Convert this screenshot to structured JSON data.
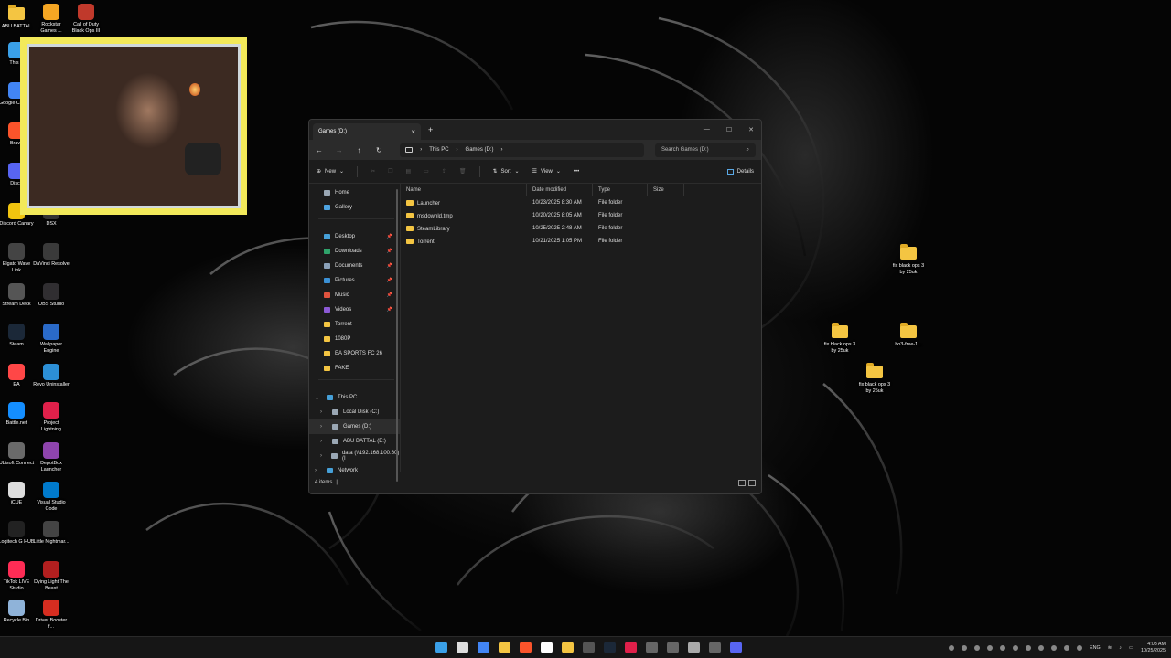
{
  "desktop": {
    "left_icons": [
      {
        "label": "ABU BATTAL",
        "icon": "folder-icon",
        "color": "#f4c542"
      },
      {
        "label": "Rockstar Games ...",
        "icon": "rockstar-icon",
        "color": "#f5a623"
      },
      {
        "label": "Call of Duty Black Ops III",
        "icon": "cod-icon",
        "color": "#c0392b"
      },
      {
        "label": "This P",
        "icon": "this-pc-icon",
        "color": "#3aa0e8"
      },
      {
        "label": "Google Chrome",
        "icon": "chrome-icon",
        "color": "#4285f4"
      },
      {
        "label": "Brave",
        "icon": "brave-icon",
        "color": "#fb542b"
      },
      {
        "label": "Disco",
        "icon": "discord-icon",
        "color": "#5865f2"
      },
      {
        "label": "Discord Canary",
        "icon": "discord-canary-icon",
        "color": "#f1c40f"
      },
      {
        "label": "DSX",
        "icon": "dsx-icon",
        "color": "#333333"
      },
      {
        "label": "Elgato Wave Link",
        "icon": "elgato-icon",
        "color": "#444444"
      },
      {
        "label": "DaVinci Resolve",
        "icon": "davinci-icon",
        "color": "#3a3a3a"
      },
      {
        "label": "Stream Deck",
        "icon": "stream-deck-icon",
        "color": "#555555"
      },
      {
        "label": "OBS Studio",
        "icon": "obs-icon",
        "color": "#302e31"
      },
      {
        "label": "Steam",
        "icon": "steam-icon",
        "color": "#1b2838"
      },
      {
        "label": "Wallpaper Engine",
        "icon": "wallpaper-engine-icon",
        "color": "#2a6ac8"
      },
      {
        "label": "EA",
        "icon": "ea-icon",
        "color": "#ff4747"
      },
      {
        "label": "Revo Uninstaller",
        "icon": "revo-icon",
        "color": "#2c8fd6"
      },
      {
        "label": "Battle.net",
        "icon": "battlenet-icon",
        "color": "#148eff"
      },
      {
        "label": "Project Lightning",
        "icon": "project-lightning-icon",
        "color": "#e0204a"
      },
      {
        "label": "Ubisoft Connect",
        "icon": "ubisoft-icon",
        "color": "#6a6a6a"
      },
      {
        "label": "DepotBox Launcher",
        "icon": "depotbox-icon",
        "color": "#8e44ad"
      },
      {
        "label": "iCUE",
        "icon": "icue-icon",
        "color": "#dddddd"
      },
      {
        "label": "Visual Studio Code",
        "icon": "vscode-icon",
        "color": "#007acc"
      },
      {
        "label": "Logitech G HUB",
        "icon": "logitech-icon",
        "color": "#222222"
      },
      {
        "label": "Little Nightmar...",
        "icon": "little-nightmares-icon",
        "color": "#444444"
      },
      {
        "label": "TikTok LIVE Studio",
        "icon": "tiktok-icon",
        "color": "#fe2c55"
      },
      {
        "label": "Dying Light The Beast",
        "icon": "dying-light-icon",
        "color": "#b21f1f"
      },
      {
        "label": "Recycle Bin",
        "icon": "recycle-bin-icon",
        "color": "#8fb3d9"
      },
      {
        "label": "Driver Booster f...",
        "icon": "driver-booster-icon",
        "color": "#d62d20"
      }
    ],
    "right_icons": [
      {
        "label": "fix black ops 3 by 25uk"
      },
      {
        "label": "fix black ops 3 by 25uk"
      },
      {
        "label": "bo3-free-1..."
      },
      {
        "label": "fix black ops 3 by 25uk"
      }
    ]
  },
  "explorer": {
    "tab_title": "Games (D:)",
    "new_tab": "+",
    "breadcrumb": [
      "This PC",
      "Games (D:)"
    ],
    "search_placeholder": "Search Games (D:)",
    "cmd": {
      "new": "New",
      "sort": "Sort",
      "view": "View",
      "more": "•••",
      "details": "Details"
    },
    "sidebar": {
      "top": [
        {
          "label": "Home",
          "icon": "home-icon",
          "color": "#9aa7b4"
        },
        {
          "label": "Gallery",
          "icon": "gallery-icon",
          "color": "#4ea3e0"
        }
      ],
      "quick": [
        {
          "label": "Desktop",
          "icon": "desktop-icon",
          "color": "#46a0d8",
          "pinned": true
        },
        {
          "label": "Downloads",
          "icon": "downloads-icon",
          "color": "#2fa36b",
          "pinned": true
        },
        {
          "label": "Documents",
          "icon": "documents-icon",
          "color": "#8aa0b8",
          "pinned": true
        },
        {
          "label": "Pictures",
          "icon": "pictures-icon",
          "color": "#3b91d6",
          "pinned": true
        },
        {
          "label": "Music",
          "icon": "music-icon",
          "color": "#e0533e",
          "pinned": true
        },
        {
          "label": "Videos",
          "icon": "videos-icon",
          "color": "#8c5ad6",
          "pinned": true
        },
        {
          "label": "Torrent",
          "icon": "folder-icon",
          "color": "#f4c542"
        },
        {
          "label": "1080P",
          "icon": "folder-icon",
          "color": "#f4c542"
        },
        {
          "label": "EA SPORTS FC 26",
          "icon": "folder-icon",
          "color": "#f4c542"
        },
        {
          "label": "FAKE",
          "icon": "folder-icon",
          "color": "#f4c542"
        }
      ],
      "this_pc": "This PC",
      "drives": [
        {
          "label": "Local Disk (C:)",
          "selected": false
        },
        {
          "label": "Games (D:)",
          "selected": true
        },
        {
          "label": "ABU BATTAL (E:)",
          "selected": false
        },
        {
          "label": "data (\\\\192.168.100.60) (I",
          "selected": false
        }
      ],
      "network": "Network"
    },
    "columns": {
      "name": "Name",
      "date": "Date modified",
      "type": "Type",
      "size": "Size"
    },
    "files": [
      {
        "name": "Launcher",
        "date": "10/23/2025 8:30 AM",
        "type": "File folder",
        "size": ""
      },
      {
        "name": "msdownld.tmp",
        "date": "10/20/2025 8:05 AM",
        "type": "File folder",
        "size": ""
      },
      {
        "name": "SteamLibrary",
        "date": "10/25/2025 2:48 AM",
        "type": "File folder",
        "size": ""
      },
      {
        "name": "Torrent",
        "date": "10/21/2025 1:05 PM",
        "type": "File folder",
        "size": ""
      }
    ],
    "status": "4 items"
  },
  "taskbar": {
    "apps": [
      "windows-start-icon",
      "search-icon",
      "chrome-icon",
      "file-explorer-icon",
      "brave-icon",
      "store-icon",
      "arrow-icon",
      "obs-icon",
      "steam-icon",
      "capcut-icon",
      "app-icon",
      "app-icon",
      "usb-icon",
      "app-icon",
      "discord-icon"
    ],
    "language": "ENG",
    "time": "4:03 AM",
    "date": "10/25/2025"
  }
}
